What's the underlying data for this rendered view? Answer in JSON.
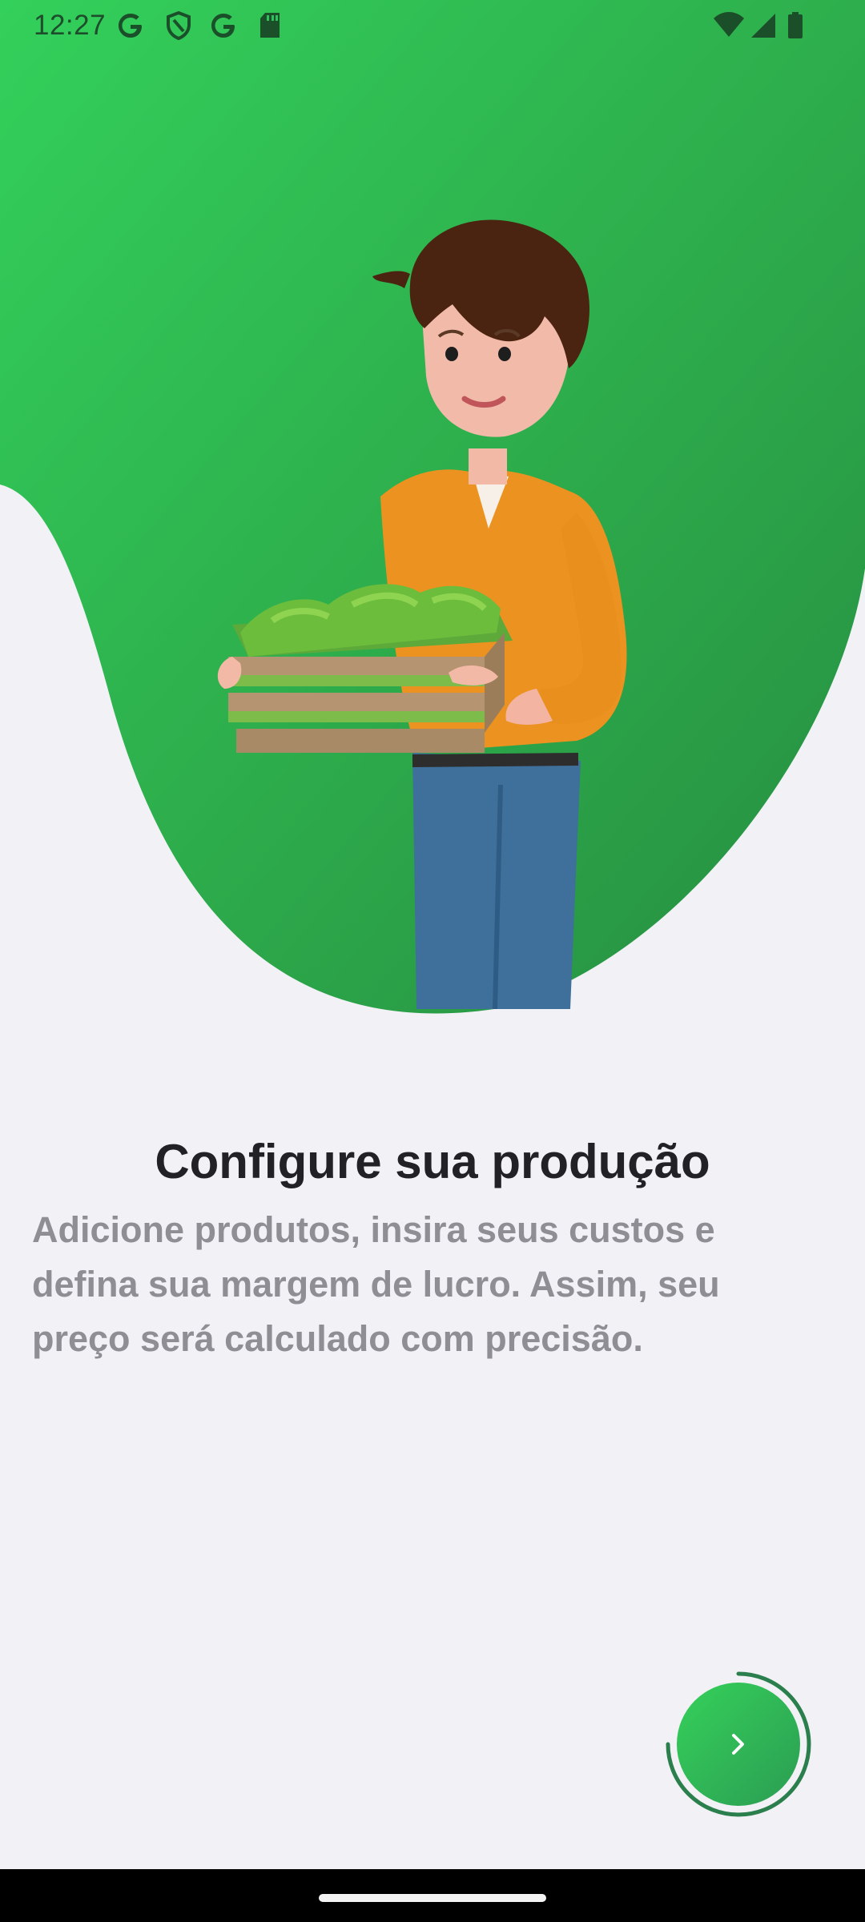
{
  "status_bar": {
    "time": "12:27",
    "left_icons": [
      "google-icon",
      "shield-icon",
      "google-icon",
      "sd-card-icon"
    ],
    "right_icons": [
      "wifi-icon",
      "signal-icon",
      "battery-icon"
    ]
  },
  "onboarding": {
    "title": "Configure sua produção",
    "description": "Adicione produtos, insira seus custos e defina sua margem de lucro. Assim, seu preço será calculado com precisão."
  },
  "next_button": {
    "icon": "chevron-right-icon"
  },
  "colors": {
    "background": "#f1f1f6",
    "accent_green": "#2fc25a",
    "dark_green": "#2a9147",
    "title": "#222226",
    "description": "#8f8e95"
  }
}
